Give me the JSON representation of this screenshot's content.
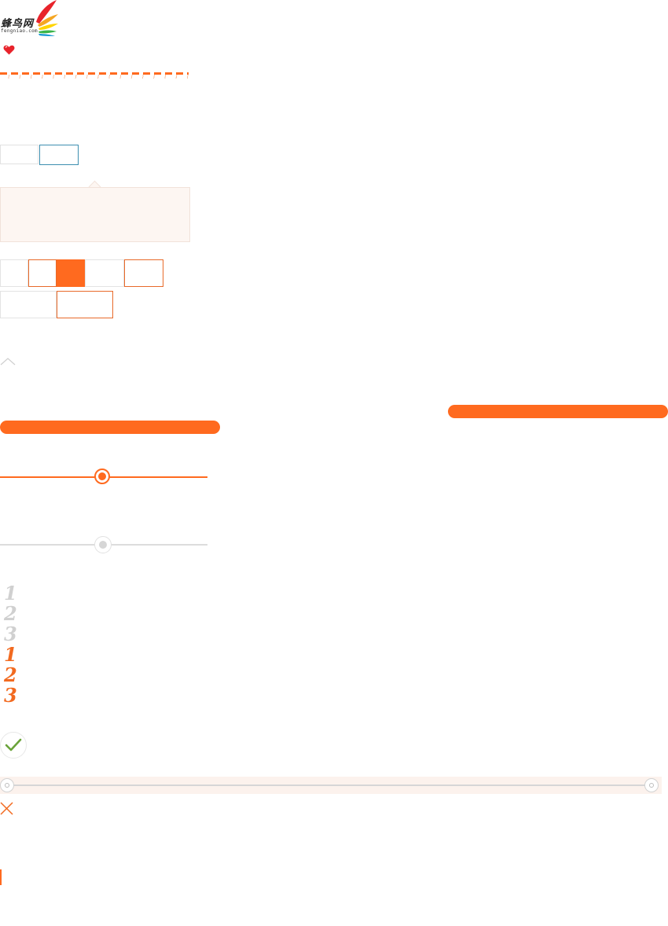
{
  "logo": {
    "name": "蜂鸟网",
    "domain": "fengniao.com"
  },
  "ranks": {
    "grey": [
      "1",
      "2",
      "3"
    ],
    "orange": [
      "1",
      "2",
      "3"
    ]
  },
  "colors": {
    "accent": "#ff6a1f",
    "tab_active_border": "#3d8fb0",
    "check_green": "#6aa33a",
    "muted": "#d0d0d0"
  },
  "sliders": [
    {
      "state": "active",
      "value": 0.5
    },
    {
      "state": "inactive",
      "value": 0.5
    }
  ],
  "icons": [
    "heart-icon",
    "caret-up-icon",
    "check-icon",
    "close-icon"
  ]
}
